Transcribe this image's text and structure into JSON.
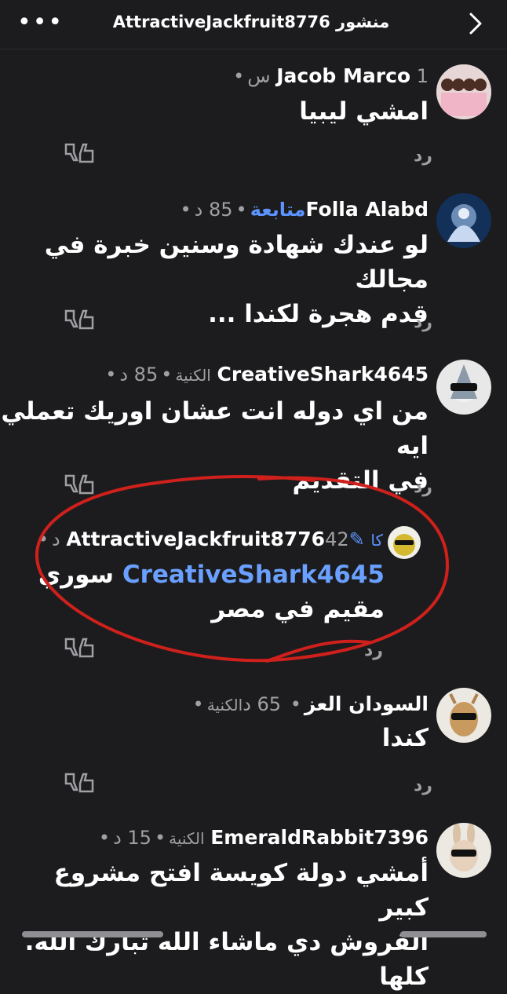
{
  "header": {
    "title": "منشور AttractiveJackfruit8776",
    "more_icon": "more-horizontal-icon",
    "back_icon": "chevron-right-icon"
  },
  "comments": [
    {
      "author": "Jacob Marco",
      "time": "1 س",
      "badge": "",
      "role": "",
      "text_lines": [
        "امشي ليبيا"
      ],
      "reply": "رد"
    },
    {
      "author": "Folla Alabd",
      "time": "85 د",
      "badge": "متابعة",
      "role": "",
      "text_lines": [
        "لو عندك شهادة وسنين خبرة في مجالك",
        "قدم هجرة لكندا ..."
      ],
      "reply": "رد"
    },
    {
      "author": "CreativeShark4645",
      "time": "85 د",
      "badge": "",
      "role": "الكنية",
      "text_lines": [
        "من اي دوله انت عشان اوريك تعملي ايه",
        "في التقديم"
      ],
      "reply": "رد"
    },
    {
      "author": "AttractiveJackfruit8776",
      "time": "42 د",
      "badge": "",
      "role": "كا",
      "mention": "CreativeShark4645",
      "text_lines": [
        "سوري",
        "مقيم في مصر"
      ],
      "reply": "رد"
    },
    {
      "author": "السودان العز",
      "time": "65 د",
      "badge": "",
      "role": "الكنية",
      "text_lines": [
        "كندا"
      ],
      "reply": "رد"
    },
    {
      "author": "EmeraldRabbit7396",
      "time": "15 د",
      "badge": "",
      "role": "الكنية",
      "text_lines": [
        "أمشي دولة كويسة افتح مشروع كبير",
        "القروش دي ماشاء الله تبارك الله. كلها"
      ],
      "reply": ""
    }
  ],
  "colors": {
    "background": "#1c1c1e",
    "accent_link": "#5b93ff",
    "annotation_circle": "#d0201c",
    "muted": "#a0a0a4"
  }
}
